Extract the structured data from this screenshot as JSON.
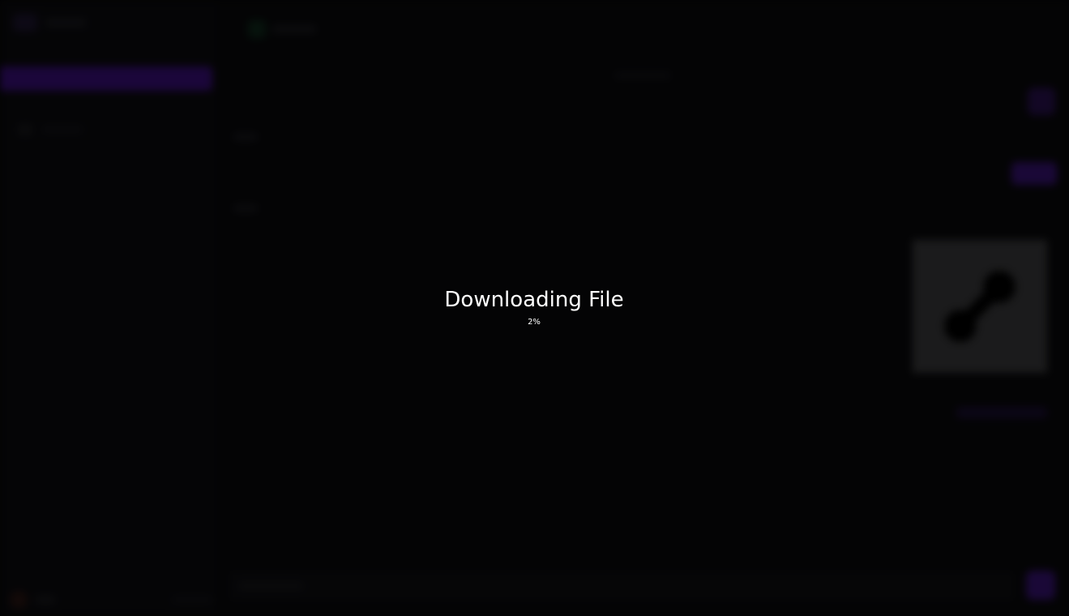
{
  "dialog": {
    "title": "Downloading File",
    "progress_text": "2%",
    "progress_value": 0.02
  },
  "colors": {
    "overlay": "#000000",
    "accent": "#3c0f80",
    "text": "#ffffff"
  },
  "icons": {
    "preview": "link-icon"
  }
}
